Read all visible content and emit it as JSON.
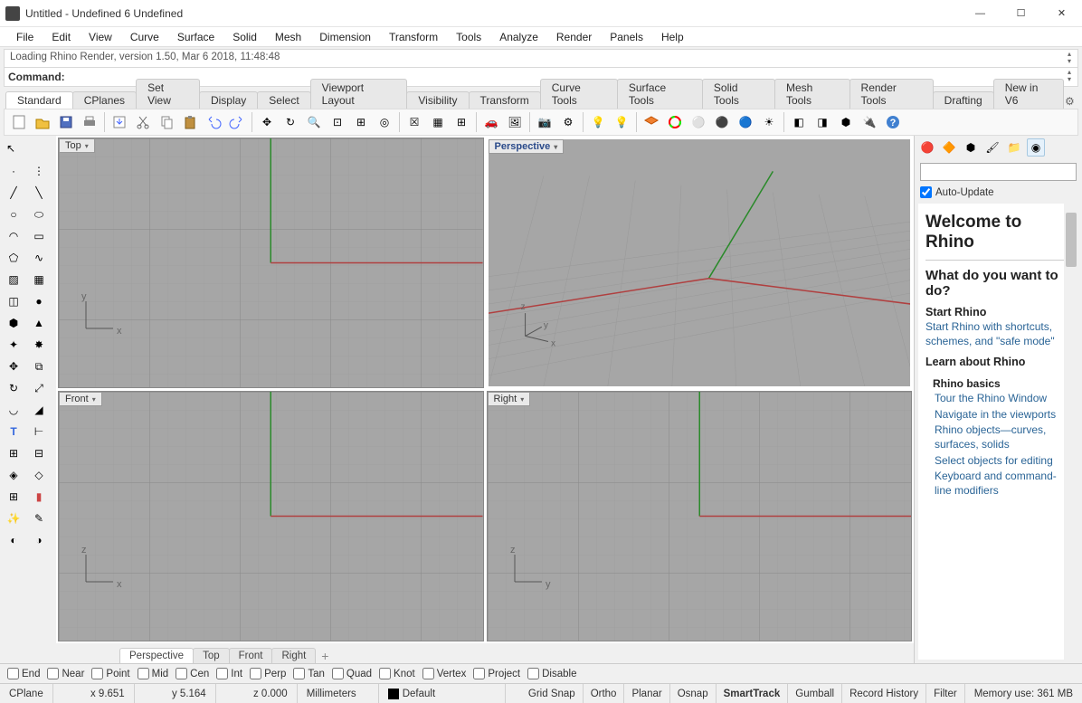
{
  "title": "Untitled - Undefined 6 Undefined",
  "menu": [
    "File",
    "Edit",
    "View",
    "Curve",
    "Surface",
    "Solid",
    "Mesh",
    "Dimension",
    "Transform",
    "Tools",
    "Analyze",
    "Render",
    "Panels",
    "Help"
  ],
  "cmd_history": "Loading Rhino Render, version 1.50, Mar  6 2018, 11:48:48",
  "cmd_label": "Command:",
  "tabs": [
    "Standard",
    "CPlanes",
    "Set View",
    "Display",
    "Select",
    "Viewport Layout",
    "Visibility",
    "Transform",
    "Curve Tools",
    "Surface Tools",
    "Solid Tools",
    "Mesh Tools",
    "Render Tools",
    "Drafting",
    "New in V6"
  ],
  "viewports": {
    "topleft": "Top",
    "topright": "Perspective",
    "botleft": "Front",
    "botright": "Right"
  },
  "axes": {
    "tl": {
      "v": "y",
      "h": "x"
    },
    "tr": {
      "v": "z",
      "h": "x",
      "d": "y"
    },
    "bl": {
      "v": "z",
      "h": "x"
    },
    "br": {
      "v": "z",
      "h": "y"
    }
  },
  "panel": {
    "auto_update": "Auto-Update",
    "welcome_h1": "Welcome to Rhino",
    "what_h2": "What do you want to do?",
    "start_h3": "Start Rhino",
    "start_link": "Start Rhino with shortcuts, schemes, and \"safe mode\"",
    "learn_h3": "Learn about Rhino",
    "basics_h4": "Rhino basics",
    "links": {
      "tour": "Tour the Rhino Window",
      "nav": "Navigate in the viewports",
      "objects": "Rhino objects—curves, surfaces, solids",
      "select": "Select objects for editing",
      "keyboard": "Keyboard and command-line modifiers"
    }
  },
  "viewtabs": [
    "Perspective",
    "Top",
    "Front",
    "Right"
  ],
  "osnap": [
    "End",
    "Near",
    "Point",
    "Mid",
    "Cen",
    "Int",
    "Perp",
    "Tan",
    "Quad",
    "Knot",
    "Vertex",
    "Project",
    "Disable"
  ],
  "status": {
    "cplane": "CPlane",
    "x": "x 9.651",
    "y": "y 5.164",
    "z": "z 0.000",
    "units": "Millimeters",
    "layer": "Default",
    "toggles": [
      "Grid Snap",
      "Ortho",
      "Planar",
      "Osnap",
      "SmartTrack",
      "Gumball",
      "Record History",
      "Filter"
    ],
    "active": "SmartTrack",
    "memory": "Memory use: 361 MB"
  }
}
